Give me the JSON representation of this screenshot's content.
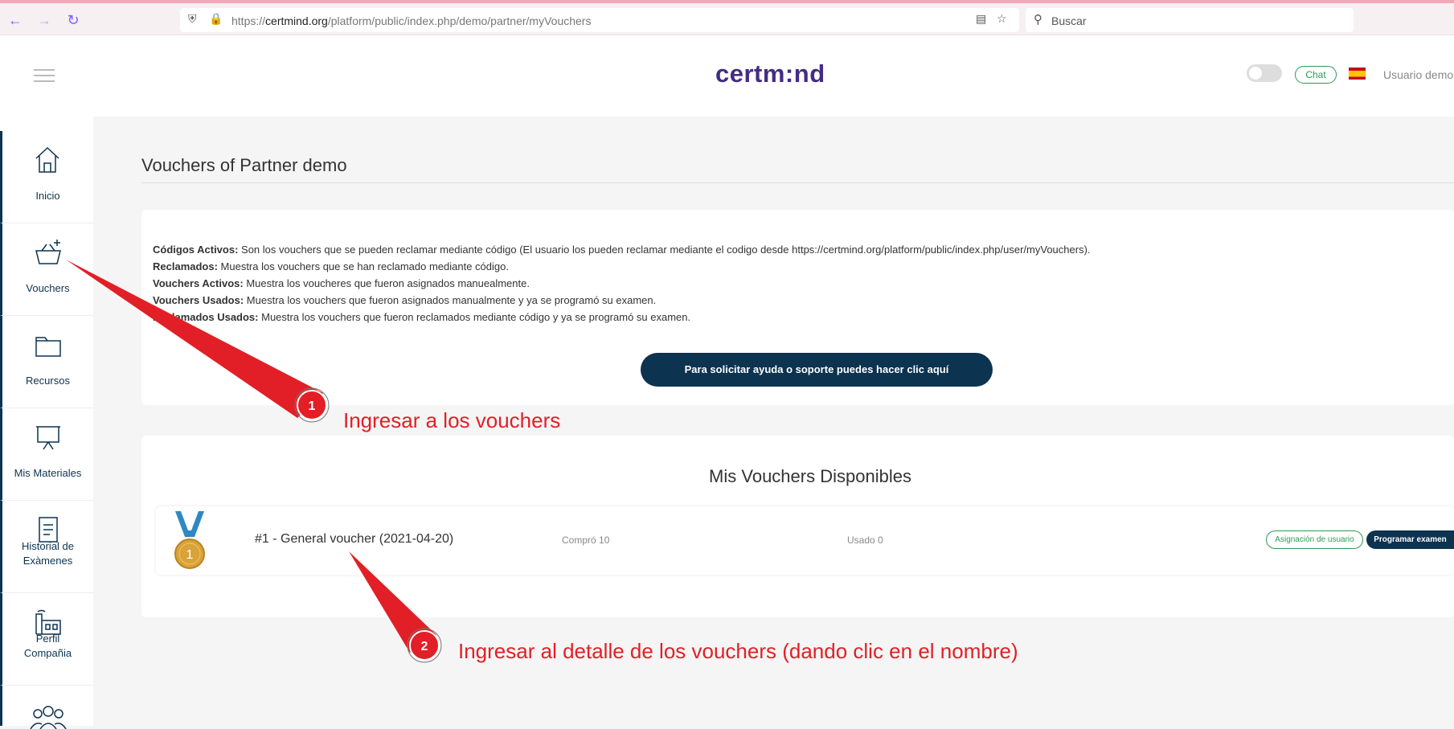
{
  "browser": {
    "url_prefix": "https://",
    "url_domain": "certmind.org",
    "url_path": "/platform/public/index.php/demo/partner/myVouchers",
    "search_placeholder": "Buscar"
  },
  "header": {
    "logo": "certm:nd",
    "chat_label": "Chat",
    "user_name": "Usuario demo"
  },
  "sidebar": {
    "items": [
      {
        "label": "Inicio"
      },
      {
        "label": "Vouchers"
      },
      {
        "label": "Recursos"
      },
      {
        "label": "Mis Materiales"
      },
      {
        "label_line1": "Historial de",
        "label_line2": "Exàmenes"
      },
      {
        "label_line1": "Perfil",
        "label_line2": "Compañia"
      }
    ]
  },
  "main": {
    "title": "Vouchers of Partner demo",
    "definitions": [
      {
        "term": "Códigos Activos:",
        "desc": " Son los vouchers que se pueden reclamar mediante código (El usuario los pueden reclamar mediante el codigo desde https://certmind.org/platform/public/index.php/user/myVouchers)."
      },
      {
        "term": "Reclamados:",
        "desc": " Muestra los vouchers que se han reclamado mediante código."
      },
      {
        "term": "Vouchers Activos:",
        "desc": " Muestra los voucheres que fueron asignados manuealmente."
      },
      {
        "term": "Vouchers Usados:",
        "desc": " Muestra los vouchers que fueron asignados manualmente y ya se programó su examen."
      },
      {
        "term": "Reclamados Usados:",
        "desc": " Muestra los vouchers que fueron reclamados mediante código y ya se programó su examen."
      }
    ],
    "help_button": "Para solicitar ayuda o soporte puedes hacer clic aquí",
    "vouchers_heading": "Mis Vouchers Disponibles",
    "voucher": {
      "medal_number": "1",
      "name": "#1 - General voucher (2021-04-20)",
      "bought": "Compró 10",
      "used": "Usado 0",
      "assign_button": "Asignación de usuario",
      "schedule_button": "Programar examen"
    }
  },
  "annotations": {
    "step1_number": "1",
    "step1_text": "Ingresar a los vouchers",
    "step2_number": "2",
    "step2_text": "Ingresar al detalle de los vouchers (dando clic en el nombre)",
    "color": "#e21f26"
  }
}
